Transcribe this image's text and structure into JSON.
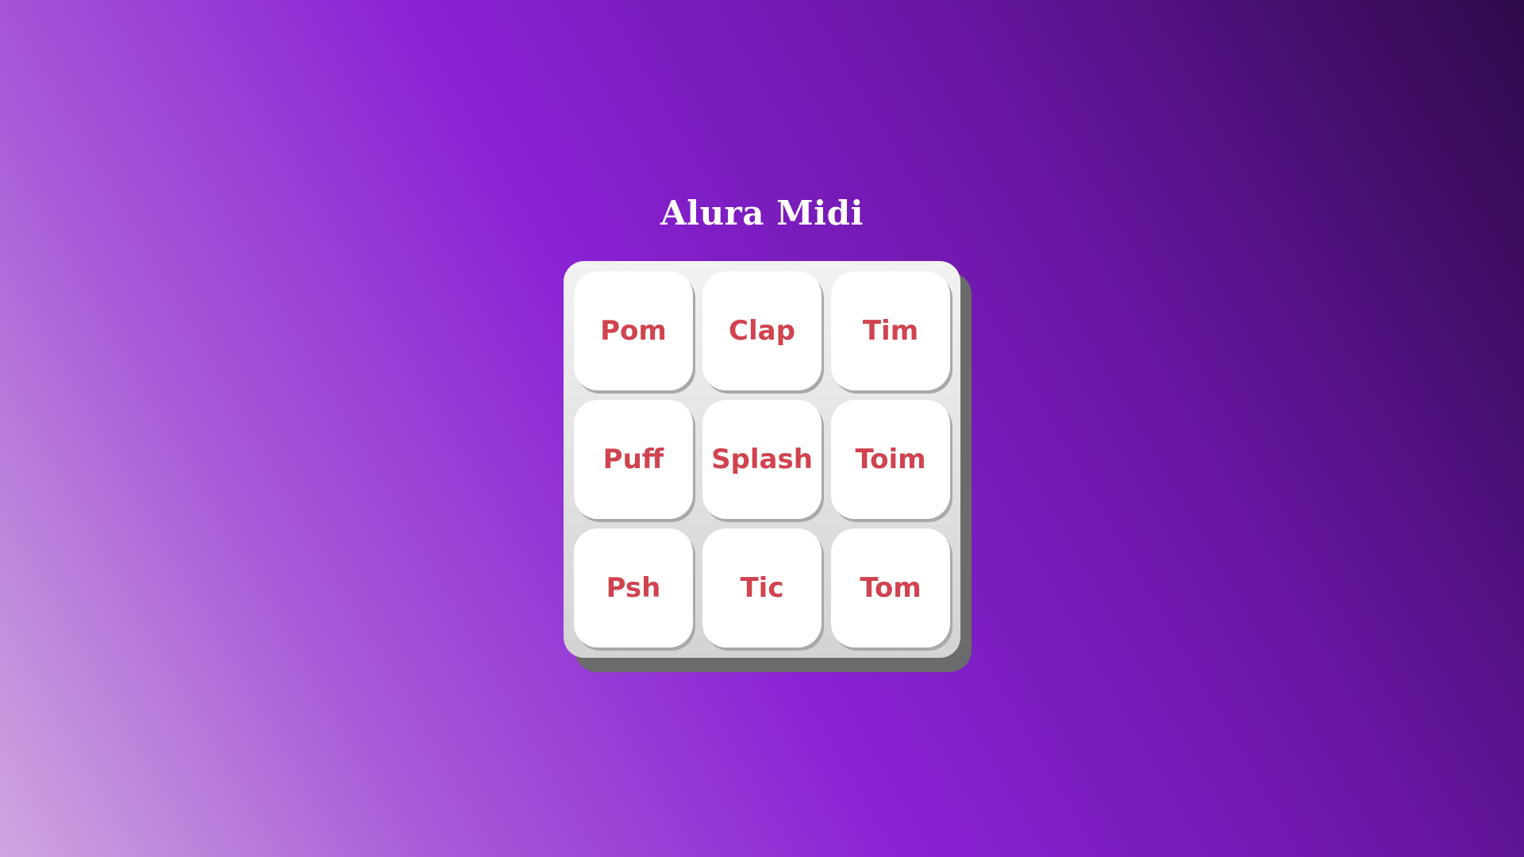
{
  "app": {
    "title": "Alura Midi"
  },
  "pad": {
    "keys": [
      {
        "label": "Pom"
      },
      {
        "label": "Clap"
      },
      {
        "label": "Tim"
      },
      {
        "label": "Puff"
      },
      {
        "label": "Splash"
      },
      {
        "label": "Toim"
      },
      {
        "label": "Psh"
      },
      {
        "label": "Tic"
      },
      {
        "label": "Tom"
      }
    ]
  },
  "colors": {
    "key_text": "#d0434f",
    "key_background": "#ffffff",
    "background_accent": "#8a22d4"
  }
}
